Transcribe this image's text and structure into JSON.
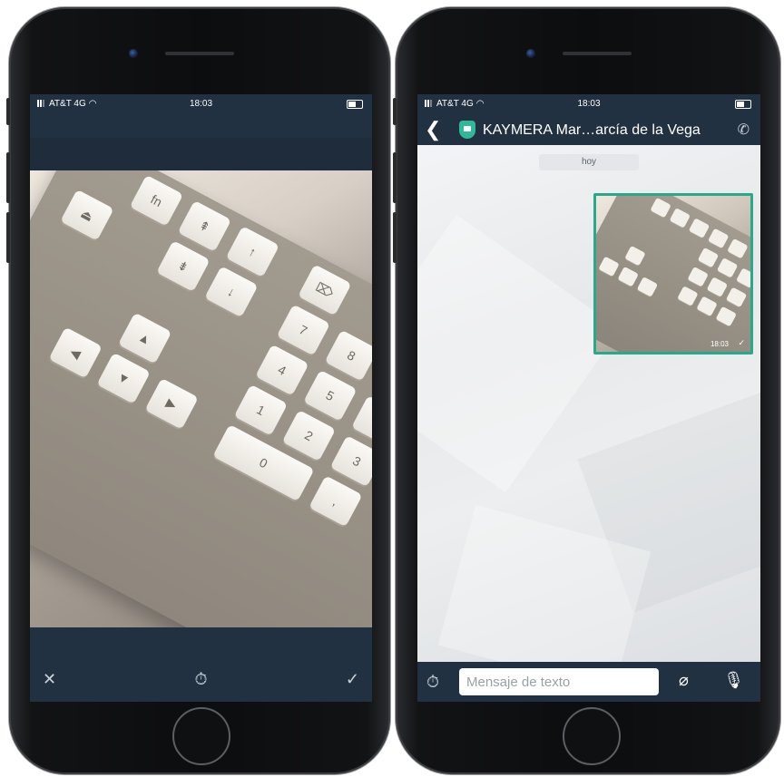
{
  "status_bar": {
    "carrier": "AT&T 4G",
    "time": "18:03"
  },
  "left_screen": {
    "name": "photo-editor",
    "keys": [
      "fn",
      "⇞",
      "⇟",
      "↑",
      "↓",
      "▲",
      "◀",
      "▼",
      "▶",
      "7",
      "8",
      "4",
      "5",
      "6",
      "1",
      "2",
      "3",
      "0",
      ",",
      "=",
      "⌦",
      "⏏"
    ],
    "toolbar": {
      "cancel_icon": "close-icon",
      "cancel_glyph": "✕",
      "timer_icon": "timer-icon",
      "timer_glyph": "⏱",
      "confirm_icon": "check-icon",
      "confirm_glyph": "✓"
    }
  },
  "right_screen": {
    "name": "chat",
    "header": {
      "back_glyph": "❮",
      "title": "KAYMERA Mar…arcía de la Vega",
      "call_glyph": "✆"
    },
    "date_separator": "hoy",
    "image_message": {
      "time": "18:03",
      "status_glyph": "✓"
    },
    "input_bar": {
      "timer_glyph": "⏱",
      "placeholder": "Mensaje de texto",
      "attach_glyph": "⌀",
      "mic_glyph": "🎙"
    }
  },
  "colors": {
    "bar_background": "#223142",
    "accent": "#2aa88a"
  }
}
